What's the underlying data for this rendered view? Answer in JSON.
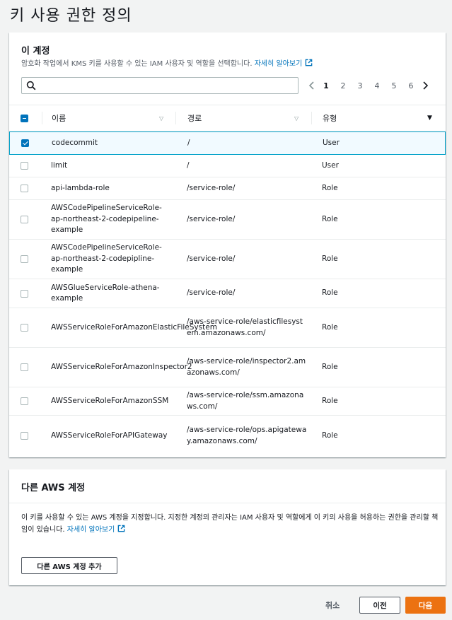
{
  "page": {
    "title": "키 사용 권한 정의"
  },
  "account_panel": {
    "title": "이 계정",
    "description": "암호화 작업에서 KMS 키를 사용할 수 있는 IAM 사용자 및 역할을 선택합니다.",
    "learn_more": "자세히 알아보기",
    "search": {
      "value": "",
      "placeholder": ""
    },
    "pagination": {
      "pages": [
        "1",
        "2",
        "3",
        "4",
        "5",
        "6"
      ],
      "current": "1"
    },
    "columns": {
      "name": "이름",
      "path": "경로",
      "type": "유형"
    },
    "rows": [
      {
        "name": "codecommit",
        "path": "/",
        "type": "User",
        "selected": true
      },
      {
        "name": "limit",
        "path": "/",
        "type": "User",
        "selected": false
      },
      {
        "name": "api-lambda-role",
        "path": "/service-role/",
        "type": "Role",
        "selected": false
      },
      {
        "name": "AWSCodePipelineServiceRole-ap-northeast-2-codepipeline-example",
        "path": "/service-role/",
        "type": "Role",
        "selected": false
      },
      {
        "name": "AWSCodePipelineServiceRole-ap-northeast-2-codepipline-example",
        "path": "/service-role/",
        "type": "Role",
        "selected": false
      },
      {
        "name": "AWSGlueServiceRole-athena-example",
        "path": "/service-role/",
        "type": "Role",
        "selected": false
      },
      {
        "name": "AWSServiceRoleForAmazonElasticFileSystem",
        "path": "/aws-service-role/elasticfilesystem.amazonaws.com/",
        "type": "Role",
        "selected": false
      },
      {
        "name": "AWSServiceRoleForAmazonInspector2",
        "path": "/aws-service-role/inspector2.amazonaws.com/",
        "type": "Role",
        "selected": false
      },
      {
        "name": "AWSServiceRoleForAmazonSSM",
        "path": "/aws-service-role/ssm.amazonaws.com/",
        "type": "Role",
        "selected": false
      },
      {
        "name": "AWSServiceRoleForAPIGateway",
        "path": "/aws-service-role/ops.apigateway.amazonaws.com/",
        "type": "Role",
        "selected": false
      }
    ]
  },
  "other_panel": {
    "title": "다른 AWS 계정",
    "description": "이 키를 사용할 수 있는 AWS 계정을 지정합니다. 지정한 계정의 관리자는 IAM 사용자 및 역할에게 이 키의 사용을 허용하는 권한을 관리할 책임이 있습니다.",
    "learn_more": "자세히 알아보기",
    "add_button": "다른 AWS 계정 추가"
  },
  "footer": {
    "cancel": "취소",
    "previous": "이전",
    "next": "다음"
  },
  "colors": {
    "accent": "#ec7211",
    "link": "#0073bb",
    "selected_border": "#00a1c9"
  },
  "icons": [
    "search-icon",
    "external-link-icon",
    "chevron-left-icon",
    "chevron-right-icon",
    "sort-icon"
  ]
}
